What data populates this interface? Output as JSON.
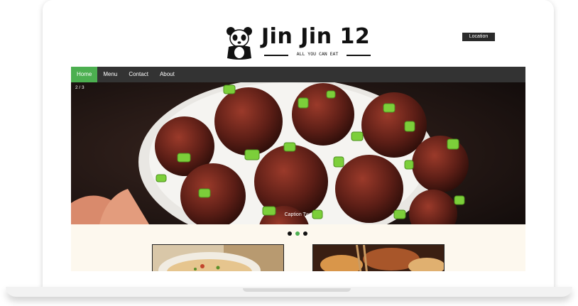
{
  "brand": {
    "name": "Jin Jin 12",
    "tagline": "ALL YOU CAN EAT",
    "logo_icon": "panda-icon"
  },
  "header": {
    "location_label": "Location"
  },
  "nav": {
    "items": [
      {
        "label": "Home",
        "active": true
      },
      {
        "label": "Menu",
        "active": false
      },
      {
        "label": "Contact",
        "active": false
      },
      {
        "label": "About",
        "active": false
      }
    ]
  },
  "slideshow": {
    "counter": "2 / 3",
    "caption": "Caption Two",
    "current_slide": 2,
    "total_slides": 3
  },
  "colors": {
    "accent": "#4caf50",
    "nav_background": "#333333",
    "section_background": "#fdf8ee"
  }
}
